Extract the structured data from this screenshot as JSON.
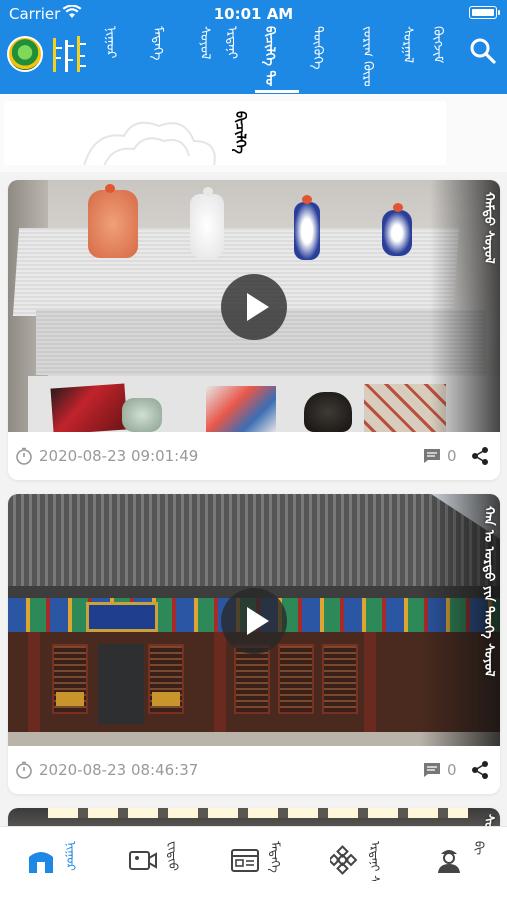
{
  "status_bar": {
    "carrier": "Carrier",
    "time": "10:01 AM"
  },
  "header": {
    "logo_text": "ᠮᠣᠩᠭᠤᠯ",
    "tabs": [
      {
        "label": "ᠨᠢᠭᠤᠷ",
        "active": false
      },
      {
        "label": "ᠮᠡᠳᠡᠭᠡ",
        "active": false
      },
      {
        "label": "ᠰᠣᠶᠣᠯ",
        "active": false
      },
      {
        "label": "ᠡᠷᠳᠡᠨᠢ",
        "active": false
      },
      {
        "label": "ᠪᠢᠴᠢᠯᠭᠡ ᠳᠦᠷᠰᠦ",
        "active": true
      },
      {
        "label": "ᠲᠦᠬᠦᠬᠡ",
        "active": false
      },
      {
        "label": "ᠵᠤᠷᠢᠭ ᠬᠦᠷᠦᠭ",
        "active": false
      },
      {
        "label": "ᠰᠤᠷᠭᠠᠯ",
        "active": false
      },
      {
        "label": "ᠬᠥᠭᠵᠢᠮ",
        "active": false
      }
    ],
    "search_icon": "search-icon"
  },
  "banner": {
    "title": "ᠪᠢᠴᠢᠯᠭᠡ ᠳᠦᠷᠰᠦ"
  },
  "cards": [
    {
      "caption": "ᠬᠠᠮᠲᠤ ᠰᠣᠶᠣᠯ",
      "date": "2020-08-23 09:01:49",
      "comments": "0"
    },
    {
      "caption": "ᠬᠠᠨ ᠤ ᠣᠷᠳᠣ ᠶᠢᠨ ᠲᠡᠦᠬᠡ ᠰᠣᠶᠣᠯ",
      "date": "2020-08-23 08:46:37",
      "comments": "0"
    },
    {
      "caption": "ᠰᠣᠶᠣᠯ"
    }
  ],
  "tabbar": [
    {
      "label": "ᠨᠢᠭᠤᠷ",
      "icon": "home-icon",
      "active": true
    },
    {
      "label": "ᠸᠢᠳᠢᠤ",
      "icon": "video-icon",
      "active": false
    },
    {
      "label": "ᠮᠡᠳᠡᠭᠡ",
      "icon": "news-card-icon",
      "active": false
    },
    {
      "label": "ᠡᠷᠳᠡᠨᠢ ᠰᠠᠩ",
      "icon": "knot-icon",
      "active": false
    },
    {
      "label": "ᠪᠢ",
      "icon": "profile-icon",
      "active": false
    }
  ],
  "colors": {
    "primary": "#1e88e5",
    "meta_text": "#999999"
  }
}
